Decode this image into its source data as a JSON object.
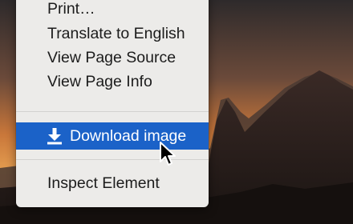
{
  "context_menu": {
    "items_top": [
      {
        "label": "Print…"
      },
      {
        "label": "Translate to English"
      },
      {
        "label": "View Page Source"
      },
      {
        "label": "View Page Info"
      }
    ],
    "highlighted_item": {
      "label": "Download image",
      "icon": "download-icon"
    },
    "items_bottom": [
      {
        "label": "Inspect Element"
      }
    ]
  },
  "colors": {
    "menu_background": "#ecebe9",
    "highlight": "#1b62c8",
    "text": "#1c1c1c",
    "separator": "#d3d2d0"
  },
  "cursor": {
    "icon": "mouse-pointer-icon"
  },
  "background": {
    "description_icon": "mountain-sunset-wallpaper"
  }
}
